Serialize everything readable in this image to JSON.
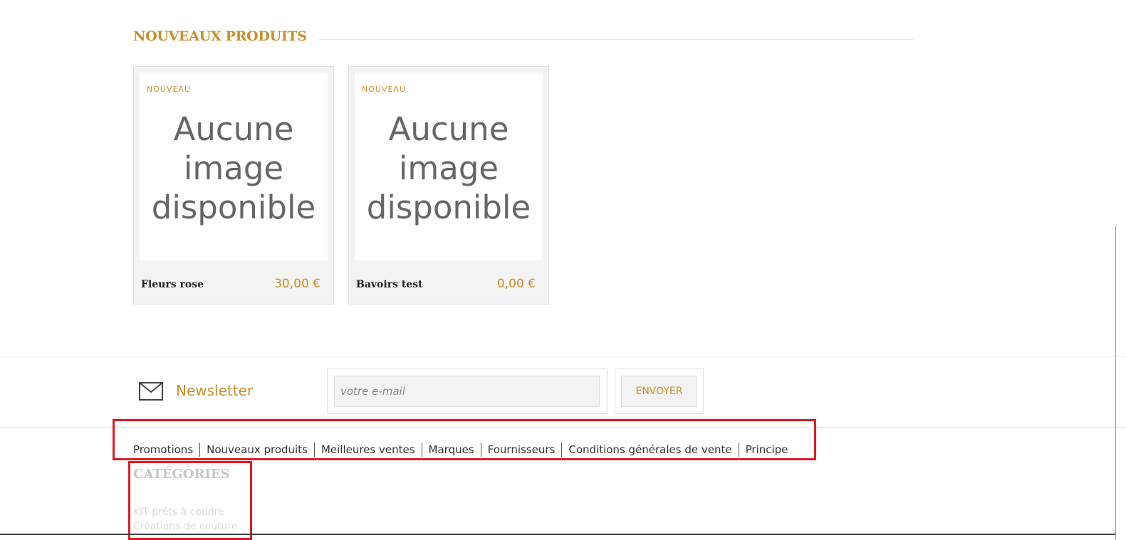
{
  "section": {
    "title": "NOUVEAUX PRODUITS"
  },
  "products": [
    {
      "badge": "NOUVEAU",
      "image_text": "Aucune image disponible",
      "name": "Fleurs rose",
      "price": "30,00 €"
    },
    {
      "badge": "NOUVEAU",
      "image_text": "Aucune image disponible",
      "name": "Bavoirs test",
      "price": "0,00 €"
    }
  ],
  "newsletter": {
    "label": "Newsletter",
    "icon": "envelope-icon",
    "placeholder": "votre e-mail",
    "value": "",
    "button_label": "ENVOYER"
  },
  "footer_links": [
    "Promotions",
    "Nouveaux produits",
    "Meilleures ventes",
    "Marques",
    "Fournisseurs",
    "Conditions générales de vente",
    "Principe"
  ],
  "categories": {
    "title": "CATÉGORIES",
    "items": [
      "KIT prêts à coudre",
      "Créations de couture"
    ]
  },
  "colors": {
    "accent": "#c98f2c",
    "highlight": "#e01b24",
    "card_bg": "#f3f3f3",
    "muted_text": "#c7c7c7"
  }
}
